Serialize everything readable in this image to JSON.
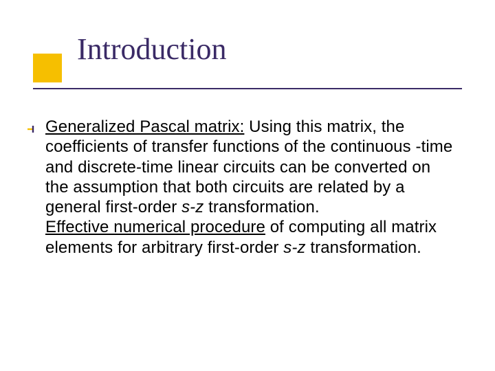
{
  "title": "Introduction",
  "body": {
    "p1": {
      "lead": "Generalized Pascal matrix:",
      "text_a": " Using this matrix, the coefficients of transfer functions of the continuous -time and discrete-time linear circuits can be converted on the assumption that both circuits are related by a general first-order ",
      "italic": "s-z",
      "text_b": " transformation."
    },
    "p2": {
      "lead": "Effective numerical procedure",
      "text_a": " of computing all matrix elements for arbitrary first-order ",
      "italic": "s-z",
      "text_b": " transformation."
    }
  }
}
